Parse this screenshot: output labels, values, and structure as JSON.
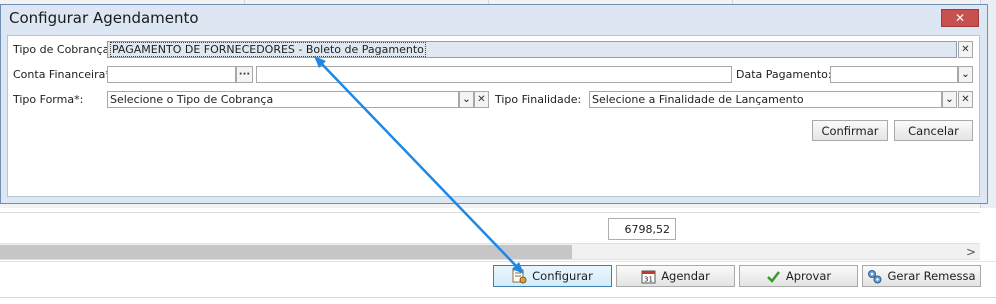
{
  "dialog": {
    "title": "Configurar Agendamento",
    "close_icon": "close-icon",
    "fields": {
      "tipo_cobranca": {
        "label": "Tipo de Cobrança:",
        "value": "PAGAMENTO DE FORNECEDORES - Boleto de Pagamento"
      },
      "conta_financeira": {
        "label": "Conta Financeira*:",
        "value": "",
        "browse_label": "···",
        "description_value": ""
      },
      "data_pagamento": {
        "label": "Data Pagamento:",
        "value": ""
      },
      "tipo_forma": {
        "label": "Tipo Forma*:",
        "value": "Selecione o Tipo de Cobrança"
      },
      "tipo_finalidade": {
        "label": "Tipo Finalidade:",
        "value": "Selecione a Finalidade de Lançamento"
      }
    },
    "buttons": {
      "confirmar": "Confirmar",
      "cancelar": "Cancelar"
    }
  },
  "background": {
    "total_value": "6798,52",
    "actions": [
      {
        "label": "Configurar",
        "icon": "configure-icon"
      },
      {
        "label": "Agendar",
        "icon": "calendar-icon",
        "badge": "31"
      },
      {
        "label": "Aprovar",
        "icon": "check-icon"
      },
      {
        "label": "Gerar Remessa",
        "icon": "gears-icon"
      }
    ]
  },
  "annotation": {
    "arrow_color": "#1e88e5"
  },
  "colors": {
    "dialog_bg": "#dce7f3",
    "close_button": "#c75050",
    "highlight_field": "#dfe8f1"
  }
}
